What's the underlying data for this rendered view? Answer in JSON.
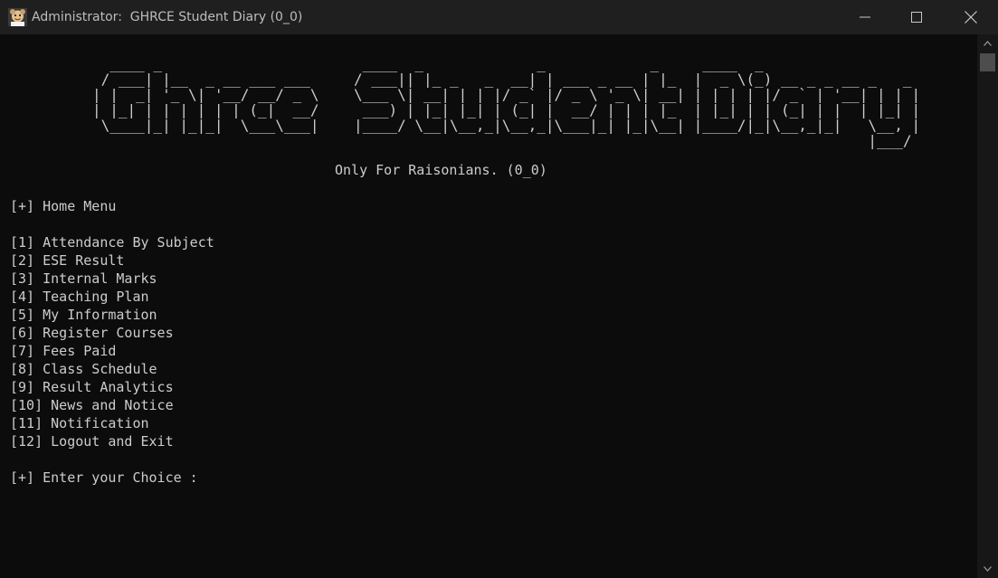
{
  "window": {
    "title": "Administrator:  GHRCE Student Diary (0_0)"
  },
  "console": {
    "banner_lines": [
      "  ____ _                       ____  _             _            _     ____  _                 ",
      " / ___| |__  _ __ ___ ___     / ___|| |_ _   _  __| | ___ _ __ | |_  |  _ \\(_) __ _ _ __ _   _ ",
      "| |  _| '_ \\| '__/ __/ _ \\    \\___ \\| __| | | |/ _` |/ _ \\ '_ \\| __| | | | | |/ _` | '__| | | |",
      "| |_| | | | | | | (_|  __/     ___) | |_| |_| | (_| |  __/ | | | |_  | |_| | | (_| | |  | |_| |",
      " \\____|_| |_|_|  \\___\\___|    |____/ \\__|\\__,_|\\__,_|\\___|_| |_|\\__| |____/|_|\\__,_|_|   \\__, |",
      "                                                                                         |___/ "
    ],
    "tagline": "Only For Raisonians. (0_0)",
    "menu_header": "[+] Home Menu",
    "menu_items": [
      "[1] Attendance By Subject",
      "[2] ESE Result",
      "[3] Internal Marks",
      "[4] Teaching Plan",
      "[5] My Information",
      "[6] Register Courses",
      "[7] Fees Paid",
      "[8] Class Schedule",
      "[9] Result Analytics",
      "[10] News and Notice",
      "[11] Notification",
      "[12] Logout and Exit"
    ],
    "prompt": "[+] Enter your Choice :"
  },
  "icons": {
    "app": "console-app-icon",
    "minimize": "minimize-icon",
    "maximize": "maximize-icon",
    "close": "close-icon",
    "scroll_up": "chevron-up-icon",
    "scroll_down": "chevron-down-icon"
  }
}
